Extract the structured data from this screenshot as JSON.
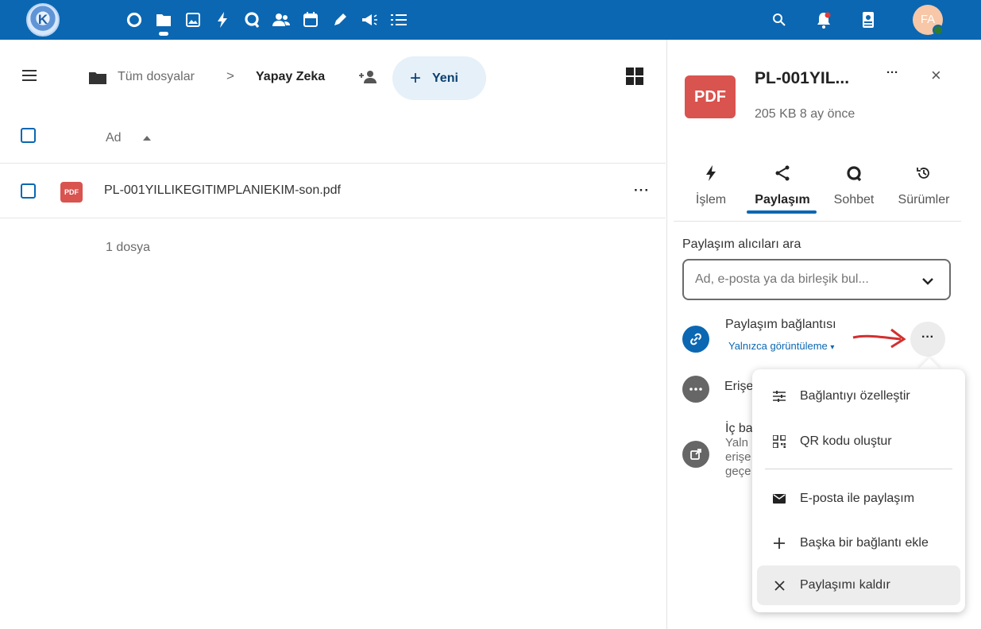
{
  "app": {
    "logo_text": "K",
    "nav_icons": [
      "dashboard-icon",
      "files-icon",
      "photos-icon",
      "activity-icon",
      "talk-icon",
      "contacts-icon",
      "calendar-icon",
      "notes-icon",
      "announcements-icon",
      "tasks-icon"
    ],
    "active_nav": "files-icon",
    "right_icons": [
      "search-icon",
      "notifications-icon",
      "contacts-menu-icon"
    ],
    "user_initials": "FA",
    "colors": {
      "topbar": "#0b67b2",
      "primary": "#0b67b2",
      "pdf": "#d9534f",
      "arrow": "#d32f2f"
    }
  },
  "breadcrumb": {
    "root": "Tüm dosyalar",
    "separator": ">",
    "current": "Yapay Zeka"
  },
  "toolbar": {
    "new_label": "Yeni"
  },
  "file_list": {
    "column_name": "Ad",
    "files": [
      {
        "type_label": "PDF",
        "name": "PL-001YILLIKEGITIMPLANIEKIM-son.pdf",
        "menu": "···"
      }
    ],
    "summary": "1 dosya"
  },
  "sidebar": {
    "thumb_label": "PDF",
    "title": "PL-001YIL...",
    "meta": "205 KB 8 ay önce",
    "more": "···",
    "close": "×",
    "tabs": [
      {
        "label": "İşlem",
        "icon": "activity-icon"
      },
      {
        "label": "Paylaşım",
        "icon": "share-icon"
      },
      {
        "label": "Sohbet",
        "icon": "chat-icon"
      },
      {
        "label": "Sürümler",
        "icon": "versions-icon"
      }
    ],
    "active_tab": "Paylaşım",
    "search_label": "Paylaşım alıcıları ara",
    "search_placeholder": "Ad, e-posta ya da birleşik bul...",
    "link": {
      "title": "Paylaşım bağlantısı",
      "mode": "Yalnızca görüntüleme",
      "mode_caret": "▾",
      "menu": "···"
    },
    "access": {
      "text": "Erişe"
    },
    "internal": {
      "title": "İç ba",
      "desc_lines": [
        "Yaln",
        "erişe",
        "geçe"
      ]
    }
  },
  "popup_menu": {
    "items": [
      {
        "label": "Bağlantıyı özelleştir",
        "icon": "tune-icon"
      },
      {
        "label": "QR kodu oluştur",
        "icon": "qr-code-icon"
      },
      {
        "label": "E-posta ile paylaşım",
        "icon": "email-icon"
      },
      {
        "label": "Başka bir bağlantı ekle",
        "icon": "plus-icon"
      },
      {
        "label": "Paylaşımı kaldır",
        "icon": "close-icon"
      }
    ]
  }
}
